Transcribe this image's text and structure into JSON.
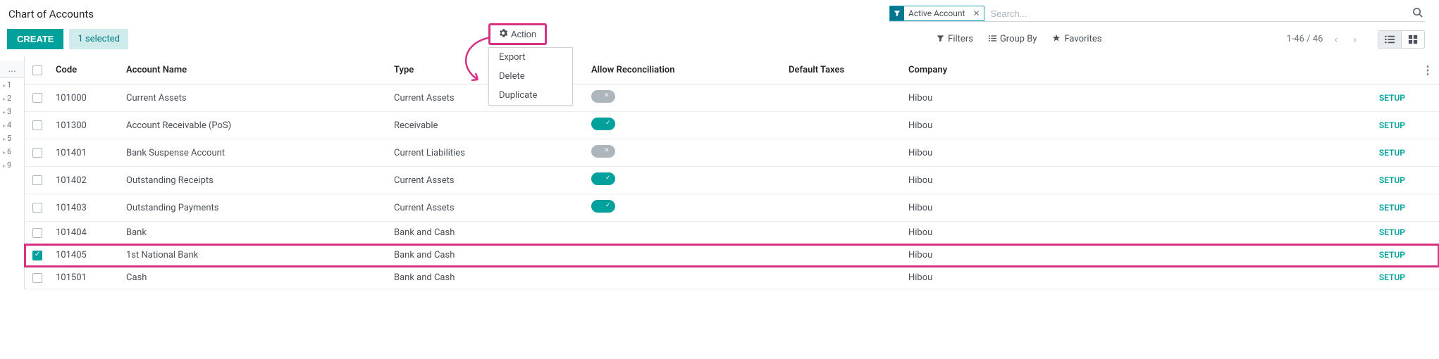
{
  "header": {
    "breadcrumb": "Chart of Accounts"
  },
  "search": {
    "facet_label": "Active Account",
    "placeholder": "Search..."
  },
  "toolbar": {
    "create_label": "CREATE",
    "selected_label": "1 selected",
    "action_label": "Action",
    "filters_label": "Filters",
    "groupby_label": "Group By",
    "favorites_label": "Favorites",
    "pager_text": "1-46 / 46"
  },
  "action_menu": {
    "export": "Export",
    "delete": "Delete",
    "duplicate": "Duplicate"
  },
  "columns": {
    "code": "Code",
    "name": "Account Name",
    "type": "Type",
    "reconcile": "Allow Reconciliation",
    "taxes": "Default Taxes",
    "company": "Company"
  },
  "ruler": [
    "1",
    "2",
    "3",
    "4",
    "5",
    "6",
    "9"
  ],
  "setup_label": "SETUP",
  "rows": [
    {
      "checked": false,
      "code": "101000",
      "name": "Current Assets",
      "type": "Current Assets",
      "reconcile": "off",
      "company": "Hibou"
    },
    {
      "checked": false,
      "code": "101300",
      "name": "Account Receivable (PoS)",
      "type": "Receivable",
      "reconcile": "on",
      "company": "Hibou"
    },
    {
      "checked": false,
      "code": "101401",
      "name": "Bank Suspense Account",
      "type": "Current Liabilities",
      "reconcile": "off",
      "company": "Hibou"
    },
    {
      "checked": false,
      "code": "101402",
      "name": "Outstanding Receipts",
      "type": "Current Assets",
      "reconcile": "on",
      "company": "Hibou"
    },
    {
      "checked": false,
      "code": "101403",
      "name": "Outstanding Payments",
      "type": "Current Assets",
      "reconcile": "on",
      "company": "Hibou"
    },
    {
      "checked": false,
      "code": "101404",
      "name": "Bank",
      "type": "Bank and Cash",
      "reconcile": "none",
      "company": "Hibou"
    },
    {
      "checked": true,
      "code": "101405",
      "name": "1st National Bank",
      "type": "Bank and Cash",
      "reconcile": "none",
      "company": "Hibou"
    },
    {
      "checked": false,
      "code": "101501",
      "name": "Cash",
      "type": "Bank and Cash",
      "reconcile": "none",
      "company": "Hibou"
    }
  ]
}
